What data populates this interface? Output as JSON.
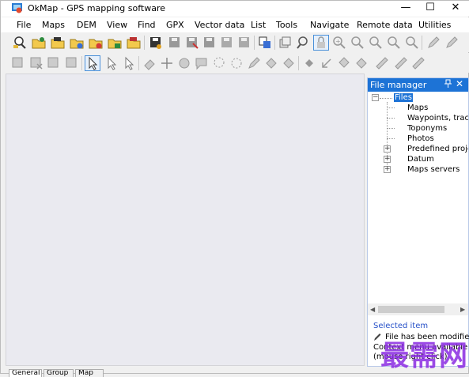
{
  "window": {
    "title": "OkMap - GPS mapping software",
    "controls": {
      "minimize": "—",
      "maximize": "☐",
      "close": "✕"
    }
  },
  "menu": {
    "items": [
      "File",
      "Maps",
      "DEM",
      "View",
      "Find",
      "GPX",
      "Vector data",
      "List",
      "Tools",
      "Navigate",
      "Remote data",
      "Utilities"
    ]
  },
  "toolbar1": {
    "icons": [
      "search-map-icon",
      "open-map-icon",
      "open-folder-icon",
      "open-folder-gear-icon",
      "open-folder-close-icon",
      "open-folder-green-icon",
      "save-icon",
      "save-gps-icon",
      "save-as-icon",
      "save-export-icon",
      "save-disabled-icon",
      "save-special-icon",
      "copy-icon",
      "find-icon",
      "lock-icon",
      "zoom-in-icon",
      "zoom-out-icon",
      "zoom-fit-icon",
      "zoom-s-icon",
      "zoom-1-icon",
      "pencil-icon",
      "pencil-settings-icon"
    ]
  },
  "toolbar2": {
    "icons": [
      "waypoint-edit-icon",
      "waypoint-delete-icon",
      "waypoint-gear-icon",
      "route-icon",
      "select-arrow-icon",
      "select-plus-icon",
      "select-box-icon",
      "eraser-icon",
      "crosshair-icon",
      "smiley-icon",
      "chat-icon",
      "lasso-icon",
      "rotate-icon",
      "edit-shape-icon",
      "fill-icon",
      "paint-icon",
      "diamond-icon",
      "arrow-sw-icon",
      "measure-icon",
      "ruler-icon",
      "ruler-diagonal-icon",
      "ruler-x-icon"
    ]
  },
  "file_manager": {
    "title": "File manager",
    "pin": "📌",
    "close": "✕",
    "root": "Files",
    "items": [
      {
        "label": "Maps",
        "expandable": false
      },
      {
        "label": "Waypoints, tracks, r",
        "expandable": false
      },
      {
        "label": "Toponyms",
        "expandable": false
      },
      {
        "label": "Photos",
        "expandable": false
      },
      {
        "label": "Predefined projectio",
        "expandable": true
      },
      {
        "label": "Datum",
        "expandable": true
      },
      {
        "label": "Maps servers",
        "expandable": true
      }
    ],
    "scroll_left": "◀",
    "scroll_right": "▶",
    "selected_item_title": "Selected item",
    "status_lines": [
      "File has been modified",
      "Context menu available",
      "(mouse right click)"
    ]
  },
  "bottom_tabs": [
    "General",
    "Group",
    "Map"
  ],
  "watermark": "最需网"
}
